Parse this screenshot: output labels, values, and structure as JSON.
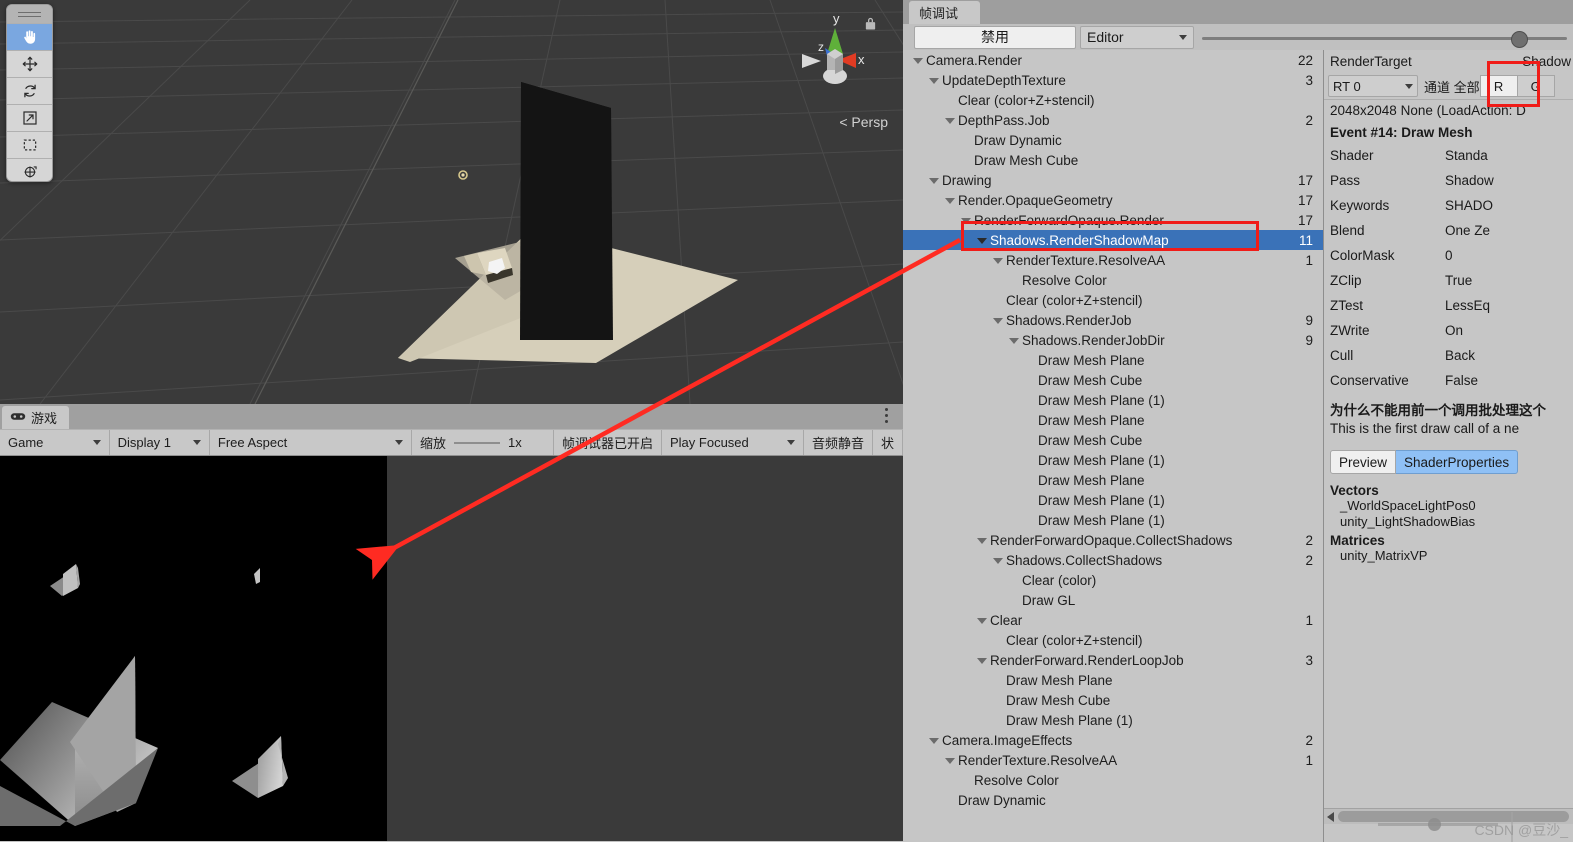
{
  "scene_view": {
    "tools": [
      {
        "name": "hand-tool",
        "icon": "hand-icon",
        "active": true
      },
      {
        "name": "move-tool",
        "icon": "move-icon",
        "active": false
      },
      {
        "name": "rotate-tool",
        "icon": "rotate-icon",
        "active": false
      },
      {
        "name": "scale-tool",
        "icon": "scale-icon",
        "active": false
      },
      {
        "name": "rect-tool",
        "icon": "rect-icon",
        "active": false
      },
      {
        "name": "transform-tool",
        "icon": "transform-icon",
        "active": false
      }
    ],
    "gizmo": {
      "axis_x": "x",
      "axis_y": "y",
      "axis_z": "z",
      "projection_label": "< Persp",
      "lock_icon": "lock-icon"
    }
  },
  "game_panel": {
    "tab_label": "游戏",
    "tab_icon": "gamepad-icon",
    "kebab_icon": "kebab-menu-icon",
    "toolbar": {
      "view_mode": "Game",
      "display": "Display 1",
      "aspect": "Free Aspect",
      "zoom_label": "缩放",
      "zoom_value": "1x",
      "frame_debugger_status": "帧调试器已开启",
      "play_mode": "Play Focused",
      "mute_audio": "音频静音",
      "stats": "状"
    }
  },
  "frame_debugger": {
    "tab_label": "帧调试",
    "toolbar": {
      "disable_button": "禁用",
      "target_dropdown": "Editor",
      "slider_position_pct": 88
    },
    "tree": [
      {
        "depth": 0,
        "label": "Camera.Render",
        "count": "22",
        "expandable": true
      },
      {
        "depth": 1,
        "label": "UpdateDepthTexture",
        "count": "3",
        "expandable": true
      },
      {
        "depth": 2,
        "label": "Clear (color+Z+stencil)",
        "count": "",
        "expandable": false
      },
      {
        "depth": 2,
        "label": "DepthPass.Job",
        "count": "2",
        "expandable": true
      },
      {
        "depth": 3,
        "label": "Draw Dynamic",
        "count": "",
        "expandable": false
      },
      {
        "depth": 3,
        "label": "Draw Mesh Cube",
        "count": "",
        "expandable": false
      },
      {
        "depth": 1,
        "label": "Drawing",
        "count": "17",
        "expandable": true
      },
      {
        "depth": 2,
        "label": "Render.OpaqueGeometry",
        "count": "17",
        "expandable": true
      },
      {
        "depth": 3,
        "label": "RenderForwardOpaque.Render",
        "count": "17",
        "expandable": true
      },
      {
        "depth": 4,
        "label": "Shadows.RenderShadowMap",
        "count": "11",
        "expandable": true,
        "selected": true
      },
      {
        "depth": 5,
        "label": "RenderTexture.ResolveAA",
        "count": "1",
        "expandable": true
      },
      {
        "depth": 6,
        "label": "Resolve Color",
        "count": "",
        "expandable": false
      },
      {
        "depth": 5,
        "label": "Clear (color+Z+stencil)",
        "count": "",
        "expandable": false
      },
      {
        "depth": 5,
        "label": "Shadows.RenderJob",
        "count": "9",
        "expandable": true
      },
      {
        "depth": 6,
        "label": "Shadows.RenderJobDir",
        "count": "9",
        "expandable": true
      },
      {
        "depth": 7,
        "label": "Draw Mesh Plane",
        "count": "",
        "expandable": false
      },
      {
        "depth": 7,
        "label": "Draw Mesh Cube",
        "count": "",
        "expandable": false
      },
      {
        "depth": 7,
        "label": "Draw Mesh Plane (1)",
        "count": "",
        "expandable": false
      },
      {
        "depth": 7,
        "label": "Draw Mesh Plane",
        "count": "",
        "expandable": false
      },
      {
        "depth": 7,
        "label": "Draw Mesh Cube",
        "count": "",
        "expandable": false
      },
      {
        "depth": 7,
        "label": "Draw Mesh Plane (1)",
        "count": "",
        "expandable": false
      },
      {
        "depth": 7,
        "label": "Draw Mesh Plane",
        "count": "",
        "expandable": false
      },
      {
        "depth": 7,
        "label": "Draw Mesh Plane (1)",
        "count": "",
        "expandable": false
      },
      {
        "depth": 7,
        "label": "Draw Mesh Plane (1)",
        "count": "",
        "expandable": false
      },
      {
        "depth": 4,
        "label": "RenderForwardOpaque.CollectShadows",
        "count": "2",
        "expandable": true
      },
      {
        "depth": 5,
        "label": "Shadows.CollectShadows",
        "count": "2",
        "expandable": true
      },
      {
        "depth": 6,
        "label": "Clear (color)",
        "count": "",
        "expandable": false
      },
      {
        "depth": 6,
        "label": "Draw GL",
        "count": "",
        "expandable": false
      },
      {
        "depth": 4,
        "label": "Clear",
        "count": "1",
        "expandable": true
      },
      {
        "depth": 5,
        "label": "Clear (color+Z+stencil)",
        "count": "",
        "expandable": false
      },
      {
        "depth": 4,
        "label": "RenderForward.RenderLoopJob",
        "count": "3",
        "expandable": true
      },
      {
        "depth": 5,
        "label": "Draw Mesh Plane",
        "count": "",
        "expandable": false
      },
      {
        "depth": 5,
        "label": "Draw Mesh Cube",
        "count": "",
        "expandable": false
      },
      {
        "depth": 5,
        "label": "Draw Mesh Plane (1)",
        "count": "",
        "expandable": false
      },
      {
        "depth": 1,
        "label": "Camera.ImageEffects",
        "count": "2",
        "expandable": true
      },
      {
        "depth": 2,
        "label": "RenderTexture.ResolveAA",
        "count": "1",
        "expandable": true
      },
      {
        "depth": 3,
        "label": "Resolve Color",
        "count": "",
        "expandable": false
      },
      {
        "depth": 2,
        "label": "Draw Dynamic",
        "count": "",
        "expandable": false
      }
    ],
    "detail": {
      "render_target_label": "RenderTarget",
      "render_target_value": "Shadow",
      "rt_select": "RT 0",
      "channel_label": "通道 全部",
      "channel_r": "R",
      "channel_g": "G",
      "rt_size": "2048x2048 None (LoadAction: D",
      "event_title": "Event #14: Draw Mesh",
      "properties": [
        {
          "key": "Shader",
          "value": "Standa"
        },
        {
          "key": "Pass",
          "value": "Shadow"
        },
        {
          "key": "Keywords",
          "value": "SHADO"
        },
        {
          "key": "Blend",
          "value": "One Ze"
        },
        {
          "key": "ColorMask",
          "value": "0"
        },
        {
          "key": "ZClip",
          "value": "True"
        },
        {
          "key": "ZTest",
          "value": "LessEq"
        },
        {
          "key": "ZWrite",
          "value": "On"
        },
        {
          "key": "Cull",
          "value": "Back"
        },
        {
          "key": "Conservative",
          "value": "False"
        }
      ],
      "why_title": "为什么不能用前一个调用批处理这个",
      "why_body": "This is the first draw call of a ne",
      "tabs": [
        {
          "label": "Preview",
          "active": false
        },
        {
          "label": "ShaderProperties",
          "active": true
        }
      ],
      "shader_properties": [
        {
          "section": "Vectors",
          "items": [
            "_WorldSpaceLightPos0",
            "unity_LightShadowBias"
          ]
        },
        {
          "section": "Matrices",
          "items": [
            "unity_MatrixVP"
          ]
        }
      ]
    }
  },
  "annotations": {
    "highlight_color": "#f01c18",
    "highlight_targets": [
      "Shadows.RenderShadowMap",
      "R"
    ],
    "arrow_from": "Shadows.RenderShadowMap",
    "arrow_to": "game-render-view"
  },
  "watermark": {
    "text": "CSDN @豆沙_"
  }
}
